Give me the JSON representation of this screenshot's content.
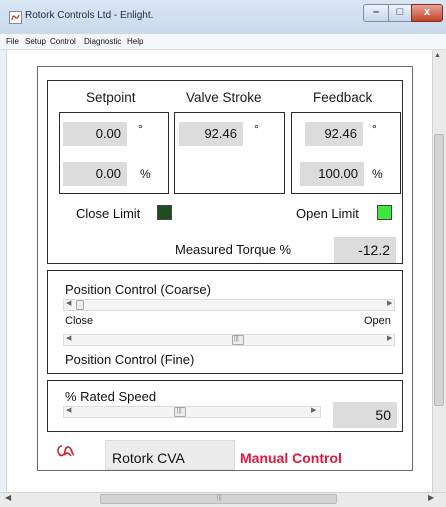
{
  "window": {
    "title": "Rotork Controls Ltd - Enlight.",
    "buttons": {
      "minimize": "–",
      "maximize": "□",
      "close": "x"
    }
  },
  "menu": [
    "File",
    "Setup",
    "Control",
    "Diagnostic",
    "Help"
  ],
  "headers": {
    "setpoint": "Setpoint",
    "valve_stroke": "Valve Stroke",
    "feedback": "Feedback"
  },
  "setpoint": {
    "degrees": "0.00",
    "degrees_unit": "°",
    "percent": "0.00",
    "percent_unit": "%"
  },
  "valve_stroke": {
    "degrees": "92.46",
    "degrees_unit": "°"
  },
  "feedback": {
    "degrees": "92.46",
    "degrees_unit": "°",
    "percent": "100.00",
    "percent_unit": "%"
  },
  "limits": {
    "close_label": "Close Limit",
    "close_color": "#1f4d1f",
    "open_label": "Open Limit",
    "open_color": "#3de83d"
  },
  "torque": {
    "label": "Measured Torque %",
    "value": "-12.2"
  },
  "position_control": {
    "coarse_label": "Position Control (Coarse)",
    "close_label": "Close",
    "open_label": "Open",
    "fine_label": "Position Control (Fine)"
  },
  "rated_speed": {
    "label": "% Rated Speed",
    "value": "50"
  },
  "footer": {
    "device": "Rotork CVA",
    "mode": "Manual Control",
    "mode_color": "#e0143c"
  }
}
